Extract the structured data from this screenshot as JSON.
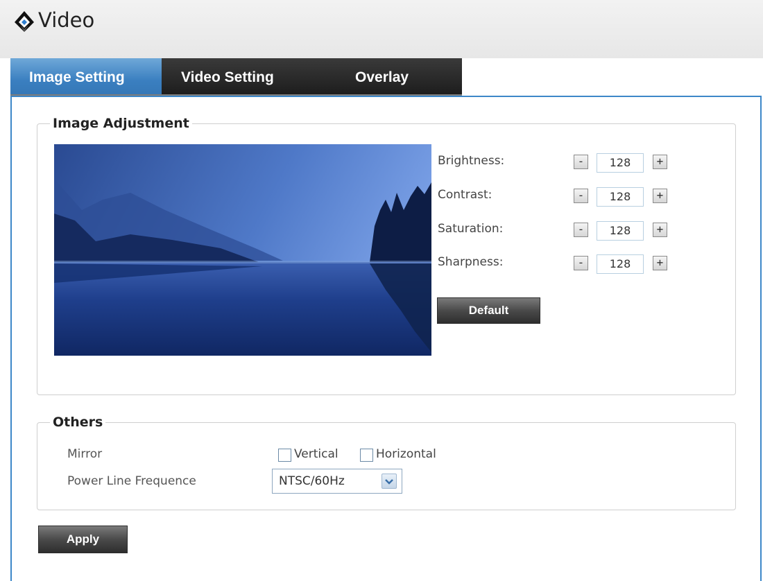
{
  "header": {
    "title": "Video"
  },
  "tabs": [
    {
      "label": "Image Setting",
      "active": true
    },
    {
      "label": "Video Setting",
      "active": false
    },
    {
      "label": "Overlay",
      "active": false
    }
  ],
  "image_adjustment": {
    "legend": "Image Adjustment",
    "controls": [
      {
        "label": "Brightness:",
        "value": "128",
        "minus": "-",
        "plus": "+"
      },
      {
        "label": "Contrast:",
        "value": "128",
        "minus": "-",
        "plus": "+"
      },
      {
        "label": "Saturation:",
        "value": "128",
        "minus": "-",
        "plus": "+"
      },
      {
        "label": "Sharpness:",
        "value": "128",
        "minus": "-",
        "plus": "+"
      }
    ],
    "default_label": "Default"
  },
  "others": {
    "legend": "Others",
    "mirror_label": "Mirror",
    "vertical_label": "Vertical",
    "horizontal_label": "Horizontal",
    "vertical_checked": false,
    "horizontal_checked": false,
    "power_line_label": "Power Line Frequence",
    "power_line_value": "NTSC/60Hz"
  },
  "apply_label": "Apply",
  "colors": {
    "accent": "#3c87c8",
    "tab_active": "#3a7fc0",
    "tab_bar": "#1c1c1c"
  }
}
